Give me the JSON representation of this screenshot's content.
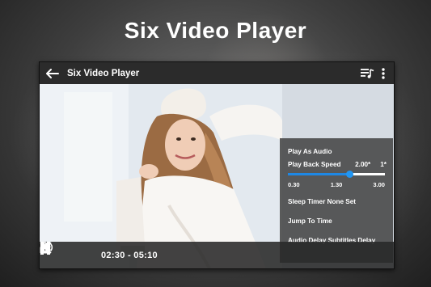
{
  "headline": "Six Video Player",
  "app_bar": {
    "title": "Six Video Player",
    "back_icon": "arrow-left-icon",
    "playlist_icon": "playlist-icon",
    "more_icon": "more-vertical-icon"
  },
  "menu": {
    "play_as_audio": "Play As Audio",
    "playback_speed_label": "Play Back Speed",
    "playback_speed_current": "2.00*",
    "playback_speed_default": "1*",
    "speed_min": "0.30",
    "speed_mid": "1.30",
    "speed_max": "3.00",
    "speed_fraction": 0.63,
    "sleep_timer": "Sleep Timer None Set",
    "jump_to_time": "Jump To Time",
    "audio_subtitles_delay": "Audio Delay Subtitles Delay"
  },
  "controls": {
    "time_display": "02:30 - 05:10",
    "pause_icon": "pause-icon",
    "volume_icon": "volume-icon",
    "lock_icon": "lock-icon",
    "shrink_icon": "collapse-icon"
  },
  "colors": {
    "accent": "#2196f3",
    "menu_bg": "#464646",
    "app_bar_bg": "#2b2b2b"
  }
}
